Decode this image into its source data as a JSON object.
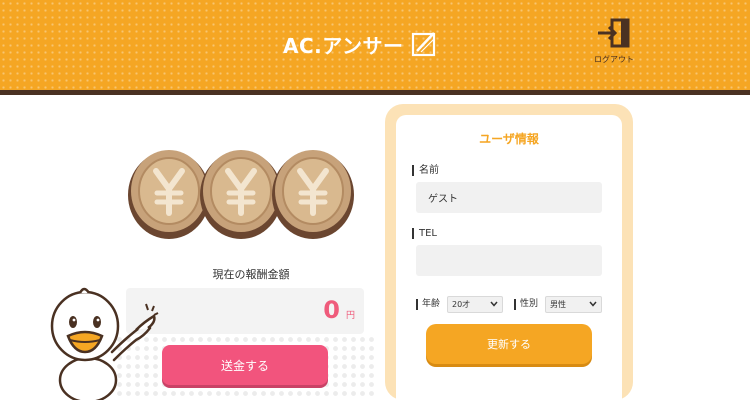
{
  "header": {
    "brand": "AC.アンサー",
    "logout_label": "ログアウト"
  },
  "reward": {
    "label": "現在の報酬金額",
    "amount": "0",
    "unit": "円",
    "send_label": "送金する"
  },
  "user_info": {
    "title": "ユーザ情報",
    "name_label": "名前",
    "name_value": "ゲスト",
    "tel_label": "TEL",
    "tel_value": "",
    "age_label": "年齢",
    "age_value": "20才",
    "gender_label": "性別",
    "gender_value": "男性",
    "update_label": "更新する"
  },
  "colors": {
    "header": "#f5a623",
    "header_bar": "#4a3122",
    "send_button": "#f2547d",
    "update_button": "#f5a623",
    "card_border": "#fce2b6",
    "amount": "#ef5b7b"
  },
  "icons": {
    "brand_logo": "pencil-square-icon",
    "logout": "logout-door-icon",
    "coin": "yen-coin-icon",
    "chevron": "chevron-down-icon"
  }
}
